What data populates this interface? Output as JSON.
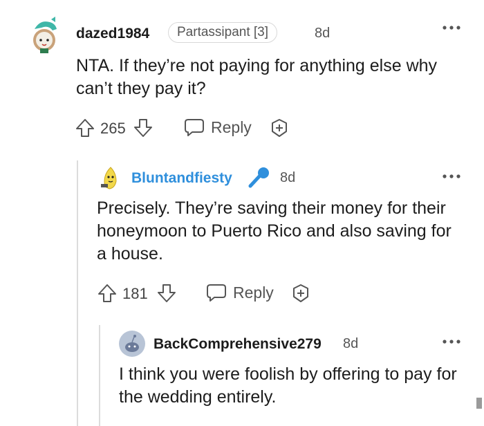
{
  "comments": [
    {
      "username": "dazed1984",
      "flair": "Partassipant [3]",
      "time": "8d",
      "body": "NTA. If they’re not paying for anything else why can’t they pay it?",
      "score": "265",
      "reply_label": "Reply",
      "avatar": "snoo-avatar-dino-icon"
    },
    {
      "username": "Bluntandfiesty",
      "time": "8d",
      "body": "Precisely. They’re saving their money for their honeymoon to Puerto Rico and also saving for a house.",
      "score": "181",
      "reply_label": "Reply",
      "avatar": "snoo-avatar-banana-icon",
      "op_badge": "microphone-icon"
    },
    {
      "username": "BackComprehensive279",
      "time": "8d",
      "body": "I think you were foolish by offering to pay for the wedding entirely.",
      "avatar": "snoo-avatar-default-icon"
    }
  ],
  "colors": {
    "op_blue": "#2f8fdc",
    "text": "#1c1c1c",
    "muted": "#555555",
    "thread_line": "#dcdcdc"
  }
}
